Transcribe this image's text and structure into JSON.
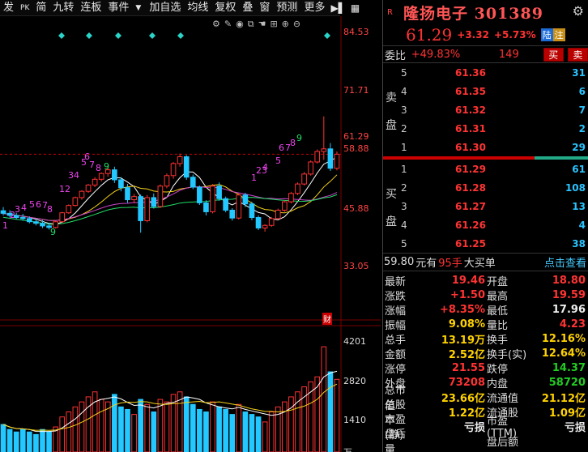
{
  "toolbar": {
    "items": [
      "发",
      "PK",
      "简",
      "九转",
      "连板",
      "事件",
      "▼",
      "加自选",
      "均线",
      "复权",
      "叠",
      "窗",
      "预测",
      "更多"
    ]
  },
  "chart": {
    "price_labels": [
      "84.53",
      "71.71",
      "61.29",
      "58.88",
      "45.88",
      "33.05"
    ],
    "volume_labels": [
      "4201",
      "2820",
      "1410"
    ],
    "volume_unit_label": "万",
    "finance_label": "财",
    "nine_turn_labels": [
      "1",
      "2",
      "3",
      "4",
      "5",
      "6",
      "7",
      "8",
      "9",
      "12",
      "34",
      "5",
      "6",
      "7",
      "8",
      "9",
      "1",
      "23",
      "4",
      "5",
      "6",
      "7",
      "8",
      "9"
    ],
    "colors": {
      "up": "#ff3333",
      "down": "#22c8ff",
      "ma5": "#ffffff",
      "ma10": "#f5d21a",
      "ma20": "#cc44cc",
      "ma60": "#22dd66"
    }
  },
  "chart_data": {
    "type": "candlestick",
    "ylim": [
      33.05,
      84.53
    ],
    "last_price": 61.29,
    "candles": [
      [
        50.5,
        51.2,
        49.6,
        50.0
      ],
      [
        50.0,
        50.6,
        49.2,
        49.6
      ],
      [
        49.6,
        50.1,
        48.8,
        49.2
      ],
      [
        49.2,
        49.9,
        48.6,
        49.0
      ],
      [
        49.0,
        49.4,
        48.1,
        48.4
      ],
      [
        48.4,
        49.0,
        47.7,
        48.1
      ],
      [
        48.1,
        48.7,
        47.2,
        47.6
      ],
      [
        47.6,
        48.2,
        46.9,
        47.3
      ],
      [
        47.3,
        48.6,
        47.1,
        48.4
      ],
      [
        48.4,
        50.3,
        48.2,
        50.1
      ],
      [
        50.1,
        51.7,
        49.9,
        51.5
      ],
      [
        51.5,
        53.2,
        51.3,
        53.0
      ],
      [
        53.0,
        54.4,
        52.6,
        54.2
      ],
      [
        54.2,
        55.6,
        53.9,
        55.4
      ],
      [
        55.4,
        56.9,
        55.0,
        56.5
      ],
      [
        56.5,
        57.8,
        56.1,
        57.6
      ],
      [
        57.6,
        58.9,
        57.0,
        58.3
      ],
      [
        58.3,
        58.9,
        55.8,
        56.4
      ],
      [
        56.4,
        56.9,
        54.2,
        54.9
      ],
      [
        54.9,
        55.6,
        52.0,
        52.6
      ],
      [
        52.6,
        53.7,
        51.9,
        53.2
      ],
      [
        53.2,
        53.6,
        46.3,
        48.6
      ],
      [
        48.6,
        53.5,
        48.3,
        53.0
      ],
      [
        53.0,
        53.8,
        50.9,
        51.3
      ],
      [
        51.3,
        55.5,
        51.0,
        55.2
      ],
      [
        55.2,
        57.6,
        54.8,
        57.2
      ],
      [
        57.2,
        59.8,
        56.6,
        59.5
      ],
      [
        59.5,
        61.4,
        58.9,
        60.8
      ],
      [
        60.8,
        61.1,
        56.4,
        56.9
      ],
      [
        56.9,
        57.4,
        54.6,
        55.0
      ],
      [
        55.0,
        55.3,
        51.6,
        52.0
      ],
      [
        52.0,
        52.5,
        49.6,
        50.3
      ],
      [
        50.3,
        55.6,
        50.0,
        55.2
      ],
      [
        55.2,
        55.9,
        52.4,
        52.8
      ],
      [
        52.8,
        53.2,
        50.2,
        50.6
      ],
      [
        50.6,
        51.0,
        48.6,
        49.1
      ],
      [
        49.1,
        53.8,
        48.8,
        53.5
      ],
      [
        53.5,
        53.9,
        51.2,
        51.8
      ],
      [
        51.8,
        52.2,
        48.7,
        49.2
      ],
      [
        49.2,
        49.6,
        46.8,
        47.2
      ],
      [
        47.2,
        47.9,
        46.5,
        47.7
      ],
      [
        47.7,
        49.3,
        47.4,
        49.0
      ],
      [
        49.0,
        50.9,
        48.8,
        50.6
      ],
      [
        50.6,
        52.5,
        50.3,
        52.2
      ],
      [
        52.2,
        54.1,
        51.9,
        53.8
      ],
      [
        53.8,
        55.9,
        53.5,
        55.6
      ],
      [
        55.6,
        57.9,
        55.3,
        57.5
      ],
      [
        57.5,
        60.1,
        57.2,
        59.8
      ],
      [
        59.8,
        62.2,
        59.5,
        61.8
      ],
      [
        61.8,
        68.5,
        60.2,
        62.3
      ],
      [
        62.3,
        63.4,
        58.1,
        58.6
      ],
      [
        58.6,
        61.8,
        58.2,
        61.29
      ]
    ],
    "volume": [
      1.1,
      0.9,
      0.8,
      0.9,
      0.8,
      0.7,
      0.9,
      0.8,
      1.0,
      1.4,
      1.6,
      1.8,
      2.0,
      2.2,
      2.4,
      2.1,
      2.0,
      2.3,
      1.8,
      1.7,
      1.5,
      2.1,
      1.9,
      1.6,
      2.1,
      2.0,
      2.3,
      2.4,
      2.2,
      1.9,
      1.7,
      1.6,
      2.0,
      1.8,
      1.7,
      1.5,
      1.9,
      1.6,
      1.5,
      1.4,
      1.2,
      1.6,
      1.8,
      2.0,
      2.2,
      2.4,
      2.6,
      2.8,
      3.0,
      4.2,
      3.2,
      2.9
    ]
  },
  "panel": {
    "title": "隆扬电子 301389",
    "price": "61.29",
    "change": "+3.32",
    "change_pct": "+5.73%",
    "tag1": "陆",
    "tag2": "注",
    "wb_label": "委比",
    "wb_pct": "+49.83%",
    "wb_diff": "149",
    "buy_btn": "买",
    "sell_btn": "卖",
    "sell_side_top": "卖",
    "sell_side_bottom": "盘",
    "buy_side_top": "买",
    "buy_side_bottom": "盘",
    "asks": [
      {
        "lv": "5",
        "px": "61.36",
        "vol": "31"
      },
      {
        "lv": "4",
        "px": "61.35",
        "vol": "6"
      },
      {
        "lv": "3",
        "px": "61.32",
        "vol": "7"
      },
      {
        "lv": "2",
        "px": "61.31",
        "vol": "2"
      },
      {
        "lv": "1",
        "px": "61.30",
        "vol": "29"
      }
    ],
    "bids": [
      {
        "lv": "1",
        "px": "61.29",
        "vol": "61"
      },
      {
        "lv": "2",
        "px": "61.28",
        "vol": "108"
      },
      {
        "lv": "3",
        "px": "61.27",
        "vol": "13"
      },
      {
        "lv": "4",
        "px": "61.26",
        "vol": "4"
      },
      {
        "lv": "5",
        "px": "61.25",
        "vol": "38"
      }
    ],
    "fill_price": "59.80",
    "fill_text1": "元有",
    "fill_hands": "95手",
    "fill_text2": "大买单",
    "fill_link": "点击查看",
    "stats": [
      {
        "k": "最新",
        "v": "19.46",
        "vc": "",
        "k2": "开盘",
        "v2": "18.80",
        "v2c": ""
      },
      {
        "k": "涨跌",
        "v": "+1.50",
        "vc": "",
        "k2": "最高",
        "v2": "19.59",
        "v2c": ""
      },
      {
        "k": "涨幅",
        "v": "+8.35%",
        "vc": "",
        "k2": "最低",
        "v2": "17.96",
        "v2c": "w"
      },
      {
        "k": "振幅",
        "v": "9.08%",
        "vc": "y",
        "k2": "量比",
        "v2": "4.23",
        "v2c": ""
      },
      {
        "k": "总手",
        "v": "13.19万",
        "vc": "y",
        "k2": "换手",
        "v2": "12.16%",
        "v2c": "y"
      },
      {
        "k": "金额",
        "v": "2.52亿",
        "vc": "y",
        "k2": "换手(实)",
        "v2": "12.64%",
        "v2c": "y"
      },
      {
        "k": "涨停",
        "v": "21.55",
        "vc": "",
        "k2": "跌停",
        "v2": "14.37",
        "v2c": "g"
      },
      {
        "k": "外盘",
        "v": "73208",
        "vc": "",
        "k2": "内盘",
        "v2": "58720",
        "v2c": "g"
      },
      {
        "k": "总市值",
        "v": "23.66亿",
        "vc": "y",
        "k2": "流通值",
        "v2": "21.12亿",
        "v2c": "y"
      },
      {
        "k": "总股本",
        "v": "1.22亿",
        "vc": "y",
        "k2": "流通股",
        "v2": "1.09亿",
        "v2c": "y"
      },
      {
        "k": "市盈(静)",
        "v": "亏损",
        "vc": "w",
        "k2": "市盈(TTM)",
        "v2": "亏损",
        "v2c": "w"
      },
      {
        "k": "盘后量",
        "v": "",
        "vc": "",
        "k2": "盘后额",
        "v2": "",
        "v2c": ""
      }
    ]
  }
}
